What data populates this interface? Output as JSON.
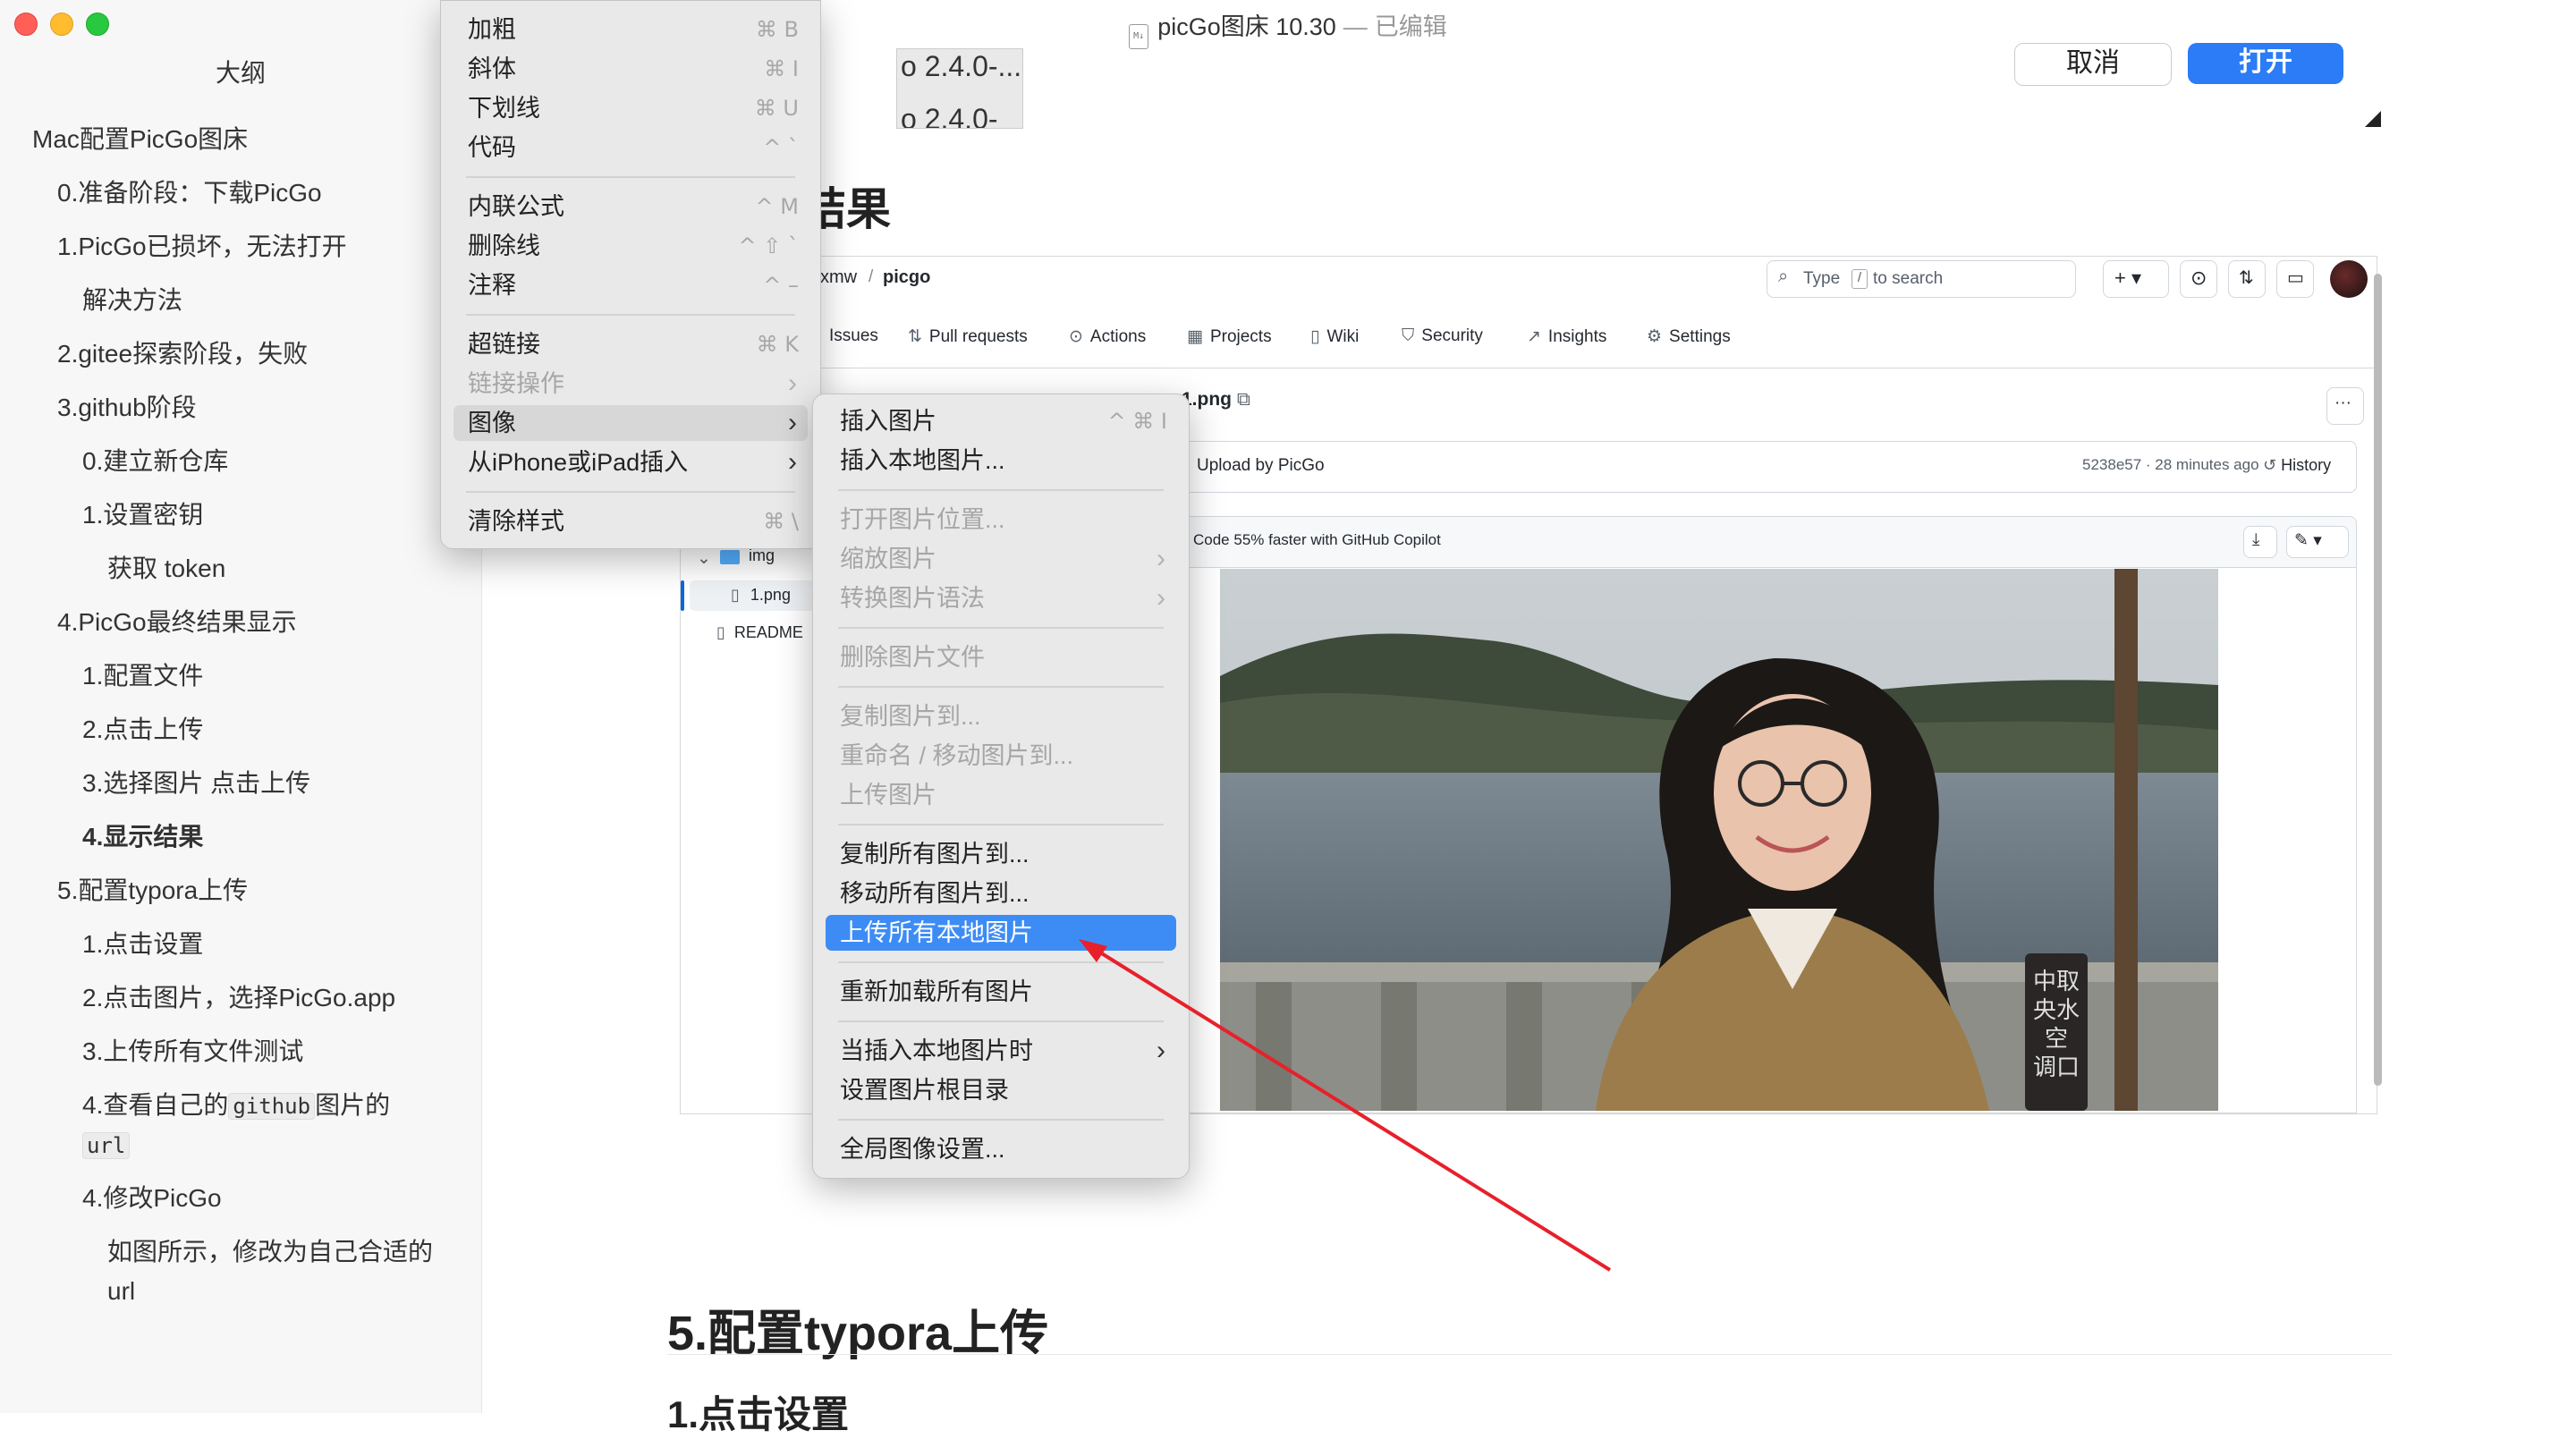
{
  "window": {
    "title": "picGo图床 10.30",
    "separator": "—",
    "status": "已编辑",
    "doc_icon": "M↓"
  },
  "outline": {
    "title": "大纲",
    "items": [
      "Mac配置PicGo图床",
      "0.准备阶段：下载PicGo",
      "1.PicGo已损坏，无法打开",
      "解决方法",
      "2.gitee探索阶段，失败",
      "3.github阶段",
      "0.建立新仓库",
      "1.设置密钥",
      "获取 token",
      "4.PicGo最终结果显示",
      "1.配置文件",
      "2.点击上传",
      "3.选择图片 点击上传",
      "4.显示结果",
      "5.配置typora上传",
      "1.点击设置",
      "2.点击图片，选择PicGo.app",
      "3.上传所有文件测试",
      "4.查看自己的",
      "github",
      "图片的",
      "url",
      "4.修改PicGo",
      "如图所示，修改为自己合适的",
      "url"
    ]
  },
  "document": {
    "dialog_snip": [
      "o 2.4.0-...",
      "o 2.4.0-"
    ],
    "cancel_button": "取消",
    "open_button": "打开",
    "heading_result": "结果",
    "heading_typora": "5.配置typora上传",
    "heading_click_settings": "1.点击设置"
  },
  "github": {
    "repo_owner": "xmw",
    "repo_sep": "/",
    "repo_name": "picgo",
    "search_placeholder": "Type",
    "search_key": "/",
    "search_suffix": "to search",
    "tabs": [
      "Issues",
      "Pull requests",
      "Actions",
      "Projects",
      "Wiki",
      "Security",
      "Insights",
      "Settings"
    ],
    "file_name": "1.png",
    "commit_message": "Upload by PicGo",
    "commit_meta": "5238e57 · 28 minutes ago",
    "history": "History",
    "copilot": "Code 55% faster with GitHub Copilot",
    "tree": [
      "img",
      "1.png",
      "READMЕ"
    ],
    "more": "···"
  },
  "menu_format": {
    "items": [
      {
        "label": "加粗",
        "shortcut": "⌘ B"
      },
      {
        "label": "斜体",
        "shortcut": "⌘ I"
      },
      {
        "label": "下划线",
        "shortcut": "⌘ U"
      },
      {
        "label": "代码",
        "shortcut": "^ `"
      },
      {
        "label": "内联公式",
        "shortcut": "^ M"
      },
      {
        "label": "删除线",
        "shortcut": "^ ⇧ `"
      },
      {
        "label": "注释",
        "shortcut": "^ –"
      },
      {
        "label": "超链接",
        "shortcut": "⌘ K"
      },
      {
        "label": "链接操作",
        "shortcut": "›"
      },
      {
        "label": "图像",
        "shortcut": "›"
      },
      {
        "label": "从iPhone或iPad插入",
        "shortcut": "›"
      },
      {
        "label": "清除样式",
        "shortcut": "⌘ \\"
      }
    ]
  },
  "menu_image": {
    "items": [
      {
        "label": "插入图片",
        "shortcut": "^ ⌘ I"
      },
      {
        "label": "插入本地图片...",
        "shortcut": ""
      },
      {
        "label": "打开图片位置...",
        "shortcut": ""
      },
      {
        "label": "缩放图片",
        "shortcut": "›"
      },
      {
        "label": "转换图片语法",
        "shortcut": "›"
      },
      {
        "label": "删除图片文件",
        "shortcut": ""
      },
      {
        "label": "复制图片到...",
        "shortcut": ""
      },
      {
        "label": "重命名 / 移动图片到...",
        "shortcut": ""
      },
      {
        "label": "上传图片",
        "shortcut": ""
      },
      {
        "label": "复制所有图片到...",
        "shortcut": ""
      },
      {
        "label": "移动所有图片到...",
        "shortcut": ""
      },
      {
        "label": "上传所有本地图片",
        "shortcut": ""
      },
      {
        "label": "重新加载所有图片",
        "shortcut": ""
      },
      {
        "label": "当插入本地图片时",
        "shortcut": "›"
      },
      {
        "label": "设置图片根目录",
        "shortcut": ""
      },
      {
        "label": "全局图像设置...",
        "shortcut": ""
      }
    ]
  },
  "photo_sign": "中取\n央水\n空\n调口",
  "colors": {
    "accent": "#3d8cf6",
    "arrow": "#e8202a",
    "open_button": "#2b7cf6"
  }
}
